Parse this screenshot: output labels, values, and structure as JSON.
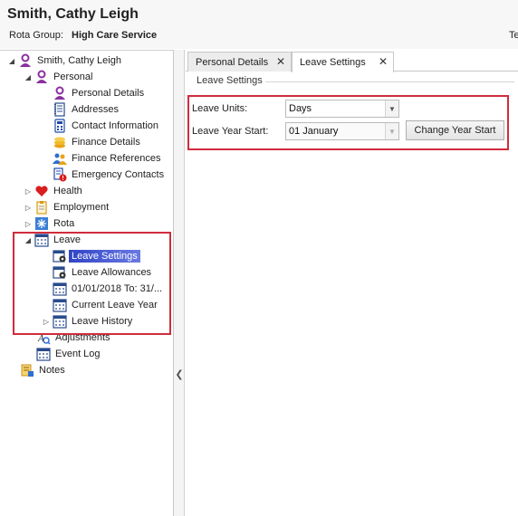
{
  "header": {
    "person_name": "Smith, Cathy Leigh",
    "rota_group_label": "Rota Group:",
    "rota_group_value": "High Care Service",
    "truncated_right_text": "Te"
  },
  "tree": {
    "root": "Smith, Cathy Leigh",
    "personal": "Personal",
    "personal_details": "Personal Details",
    "addresses": "Addresses",
    "contact_information": "Contact Information",
    "finance_details": "Finance Details",
    "finance_references": "Finance References",
    "emergency_contacts": "Emergency Contacts",
    "health": "Health",
    "employment": "Employment",
    "rota": "Rota",
    "leave": "Leave",
    "leave_settings": "Leave Settings",
    "leave_allowances": "Leave Allowances",
    "leave_period": "01/01/2018 To: 31/...",
    "current_leave_year": "Current Leave Year",
    "leave_history": "Leave History",
    "adjustments": "Adjustments",
    "event_log": "Event Log",
    "notes": "Notes"
  },
  "tabs": [
    {
      "label": "Personal Details"
    },
    {
      "label": "Leave Settings"
    }
  ],
  "leave_settings": {
    "section_title": "Leave Settings",
    "units_label": "Leave Units:",
    "units_value": "Days",
    "year_start_label": "Leave Year Start:",
    "year_start_value": "01 January",
    "change_button": "Change Year Start"
  },
  "colors": {
    "selection": "#2f44c6",
    "highlight_box": "#d02c3c",
    "person_icon": "#8a2fa0",
    "health_heart": "#d81e1e"
  },
  "icons": {
    "close": "close-icon",
    "collapse_panel": "chevron-left-icon",
    "dropdown": "chevron-down-icon"
  }
}
